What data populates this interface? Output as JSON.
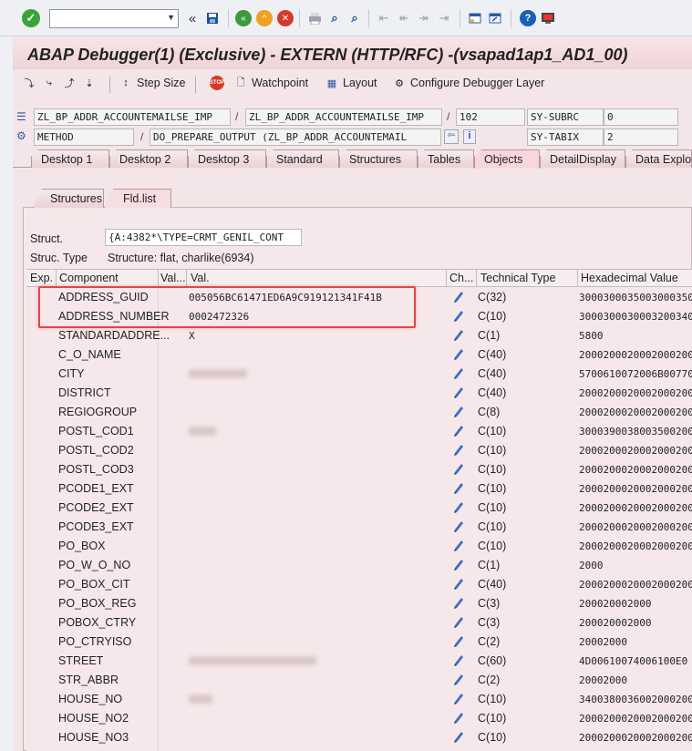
{
  "toolbar": {
    "command_value": "",
    "icons": [
      "check-icon",
      "back-icon",
      "save-icon",
      "back-green-icon",
      "exit-icon",
      "cancel-icon",
      "print-icon",
      "find-icon",
      "find-next-icon",
      "first-page-icon",
      "prev-page-icon",
      "next-page-icon",
      "last-page-icon",
      "create-session-icon",
      "shortcut-icon",
      "help-icon",
      "customize-icon"
    ]
  },
  "title": "ABAP Debugger(1)  (Exclusive) - EXTERN (HTTP/RFC) -(vsapad1ap1_AD1_00)",
  "app_toolbar": {
    "step_size": "Step Size",
    "watchpoint": "Watchpoint",
    "layout": "Layout",
    "configure": "Configure Debugger Layer"
  },
  "context": {
    "program": "ZL_BP_ADDR_ACCOUNTEMAILSE_IMP",
    "include": "ZL_BP_ADDR_ACCOUNTEMAILSE_IMP",
    "line": "102",
    "subrc_label": "SY-SUBRC",
    "subrc_value": "0",
    "event_type": "METHOD",
    "event": "DO_PREPARE_OUTPUT (ZL_BP_ADDR_ACCOUNTEMAIL",
    "tabix_label": "SY-TABIX",
    "tabix_value": "2"
  },
  "tabs": [
    "Desktop 1",
    "Desktop 2",
    "Desktop 3",
    "Standard",
    "Structures",
    "Tables",
    "Objects",
    "DetailDisplay",
    "Data Explore"
  ],
  "active_tab": "Objects",
  "subtabs": [
    "Structures",
    "Fld.list"
  ],
  "struct": {
    "label": "Struct.",
    "value": "{A:4382*\\TYPE=CRMT_GENIL_CONT",
    "type_label": "Struc. Type",
    "type_value": "Structure: flat, charlike(6934)"
  },
  "grid": {
    "headers": [
      "Exp.",
      "Component",
      "Val...",
      "Val.",
      "Ch...",
      "Technical Type",
      "Hexadecimal Value"
    ],
    "rows": [
      {
        "component": "ADDRESS_GUID",
        "val": "005056BC61471ED6A9C919121341F41B",
        "type": "C(32)",
        "hex": "3000300035003000350"
      },
      {
        "component": "ADDRESS_NUMBER",
        "val": "0002472326",
        "type": "C(10)",
        "hex": "3000300030003200340"
      },
      {
        "component": "STANDARDADDRE...",
        "val": "X",
        "type": "C(1)",
        "hex": "5800"
      },
      {
        "component": "C_O_NAME",
        "val": "",
        "type": "C(40)",
        "hex": "2000200020002000200"
      },
      {
        "component": "CITY",
        "val": "",
        "type": "C(40)",
        "hex": "5700610072006B00770"
      },
      {
        "component": "DISTRICT",
        "val": "",
        "type": "C(40)",
        "hex": "2000200020002000200"
      },
      {
        "component": "REGIOGROUP",
        "val": "",
        "type": "C(8)",
        "hex": "2000200020002000200"
      },
      {
        "component": "POSTL_COD1",
        "val": "",
        "type": "C(10)",
        "hex": "3000390038003500200"
      },
      {
        "component": "POSTL_COD2",
        "val": "",
        "type": "C(10)",
        "hex": "2000200020002000200"
      },
      {
        "component": "POSTL_COD3",
        "val": "",
        "type": "C(10)",
        "hex": "2000200020002000200"
      },
      {
        "component": "PCODE1_EXT",
        "val": "",
        "type": "C(10)",
        "hex": "2000200020002000200"
      },
      {
        "component": "PCODE2_EXT",
        "val": "",
        "type": "C(10)",
        "hex": "2000200020002000200"
      },
      {
        "component": "PCODE3_EXT",
        "val": "",
        "type": "C(10)",
        "hex": "2000200020002000200"
      },
      {
        "component": "PO_BOX",
        "val": "",
        "type": "C(10)",
        "hex": "2000200020002000200"
      },
      {
        "component": "PO_W_O_NO",
        "val": "",
        "type": "C(1)",
        "hex": "2000"
      },
      {
        "component": "PO_BOX_CIT",
        "val": "",
        "type": "C(40)",
        "hex": "2000200020002000200"
      },
      {
        "component": "PO_BOX_REG",
        "val": "",
        "type": "C(3)",
        "hex": "200020002000"
      },
      {
        "component": "POBOX_CTRY",
        "val": "",
        "type": "C(3)",
        "hex": "200020002000"
      },
      {
        "component": "PO_CTRYISO",
        "val": "",
        "type": "C(2)",
        "hex": "20002000"
      },
      {
        "component": "STREET",
        "val": "",
        "type": "C(60)",
        "hex": "4D00610074006100E0"
      },
      {
        "component": "STR_ABBR",
        "val": "",
        "type": "C(2)",
        "hex": "20002000"
      },
      {
        "component": "HOUSE_NO",
        "val": "",
        "type": "C(10)",
        "hex": "3400380036002000200"
      },
      {
        "component": "HOUSE_NO2",
        "val": "",
        "type": "C(10)",
        "hex": "2000200020002000200"
      },
      {
        "component": "HOUSE_NO3",
        "val": "",
        "type": "C(10)",
        "hex": "2000200020002000200"
      }
    ]
  },
  "colors": {
    "highlight": "#e04646",
    "title_bg": "#efd3d8",
    "panel_bg": "#f6e8ea"
  }
}
